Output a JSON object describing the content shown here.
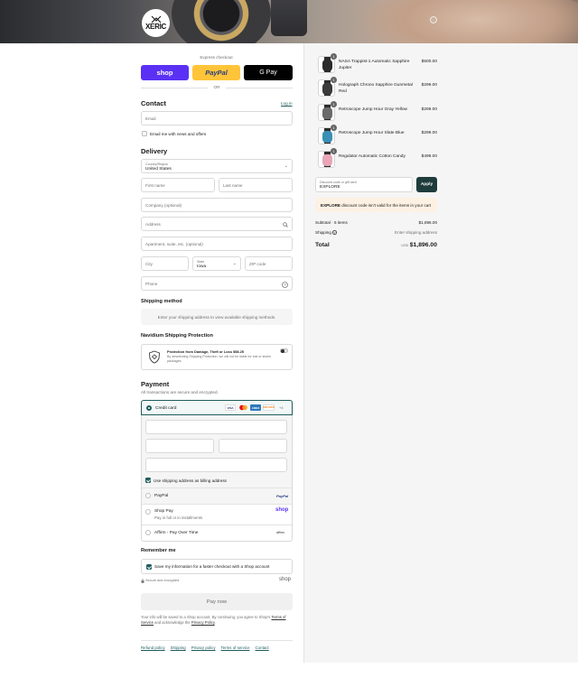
{
  "header": {
    "logo_text": "XERIC"
  },
  "express": {
    "label": "Express checkout",
    "shop_label": "shop",
    "paypal_label": "PayPal",
    "gpay_label": "G Pay",
    "or_label": "OR",
    "colors": {
      "shop": "#5a31f4",
      "paypal": "#ffc439",
      "gpay": "#000000"
    }
  },
  "contact": {
    "title": "Contact",
    "login_link": "Log in",
    "email_placeholder": "Email",
    "news_label": "Email me with news and offers"
  },
  "delivery": {
    "title": "Delivery",
    "country_label": "Country/Region",
    "country_value": "United States",
    "first_name_placeholder": "First name",
    "last_name_placeholder": "Last name",
    "company_placeholder": "Company (optional)",
    "address_placeholder": "Address",
    "apartment_placeholder": "Apartment, suite, etc. (optional)",
    "city_placeholder": "City",
    "state_label": "State",
    "state_value": "Iowa",
    "zip_placeholder": "ZIP code",
    "phone_placeholder": "Phone"
  },
  "shipping_method": {
    "title": "Shipping method",
    "notice": "Enter your shipping address to view available shipping methods."
  },
  "protection": {
    "title": "Navidium Shipping Protection",
    "line1": "Protection from Damage, Theft or Loss $58.25",
    "line2": "By deselecting Shipping Protection, we will not be liable for lost or stolen packages."
  },
  "payment": {
    "title": "Payment",
    "subtitle": "All transactions are secure and encrypted.",
    "credit_card_label": "Credit card",
    "card_brands": [
      "VISA",
      "MC",
      "AMEX",
      "DISCOVER",
      "+4"
    ],
    "billing_same_label": "Use shipping address as billing address",
    "paypal_label": "PayPal",
    "paypal_logo": "PayPal",
    "shoppay_label": "Shop Pay",
    "shoppay_sub": "Pay in full or in installments",
    "shoppay_logo": "shop",
    "affirm_label": "Affirm - Pay Over Time",
    "affirm_logo": "affirm"
  },
  "remember": {
    "title": "Remember me",
    "save_label": "Save my information for a faster checkout with a Shop account",
    "secure_label": "Secure and encrypted",
    "shop_logo": "shop"
  },
  "pay_button": "Pay now",
  "legal": {
    "text_before": "Your info will be saved to a Shop account. By continuing, you agree to Shop's",
    "terms_link": "Terms of Service",
    "text_mid": "and acknowledge the",
    "privacy_link": "Privacy Policy",
    "text_end": "."
  },
  "footer_links": [
    "Refund policy",
    "Shipping",
    "Privacy policy",
    "Terms of service",
    "Contact"
  ],
  "summary": {
    "items": [
      {
        "name": "NASA Trappist-1 Automatic Sapphire Jupiter",
        "price": "$500.00",
        "qty": "1",
        "face": "#2a2a2a"
      },
      {
        "name": "Holograph Chrono Sapphire Gunmetal Red",
        "price": "$299.00",
        "qty": "1",
        "face": "#3a3a3a"
      },
      {
        "name": "Retroscope Jump Hour Gray Yellow",
        "price": "$299.00",
        "qty": "1",
        "face": "#6b6b6b"
      },
      {
        "name": "Retroscope Jump Hour Slate Blue",
        "price": "$299.00",
        "qty": "1",
        "face": "#3a8fb5"
      },
      {
        "name": "Regulator Automatic Cotton Candy",
        "price": "$499.00",
        "qty": "1",
        "face": "#e8a6b8"
      }
    ],
    "discount_label": "Discount code or gift card",
    "discount_value": "EXPLORE",
    "apply_label": "Apply",
    "error_code": "EXPLORE",
    "error_text": "discount code isn't valid for the items in your cart",
    "subtotal_label": "Subtotal · 5 items",
    "subtotal_value": "$1,896.00",
    "shipping_label": "Shipping",
    "shipping_value": "Enter shipping address",
    "total_label": "Total",
    "currency": "USD",
    "total_value": "$1,896.00"
  }
}
